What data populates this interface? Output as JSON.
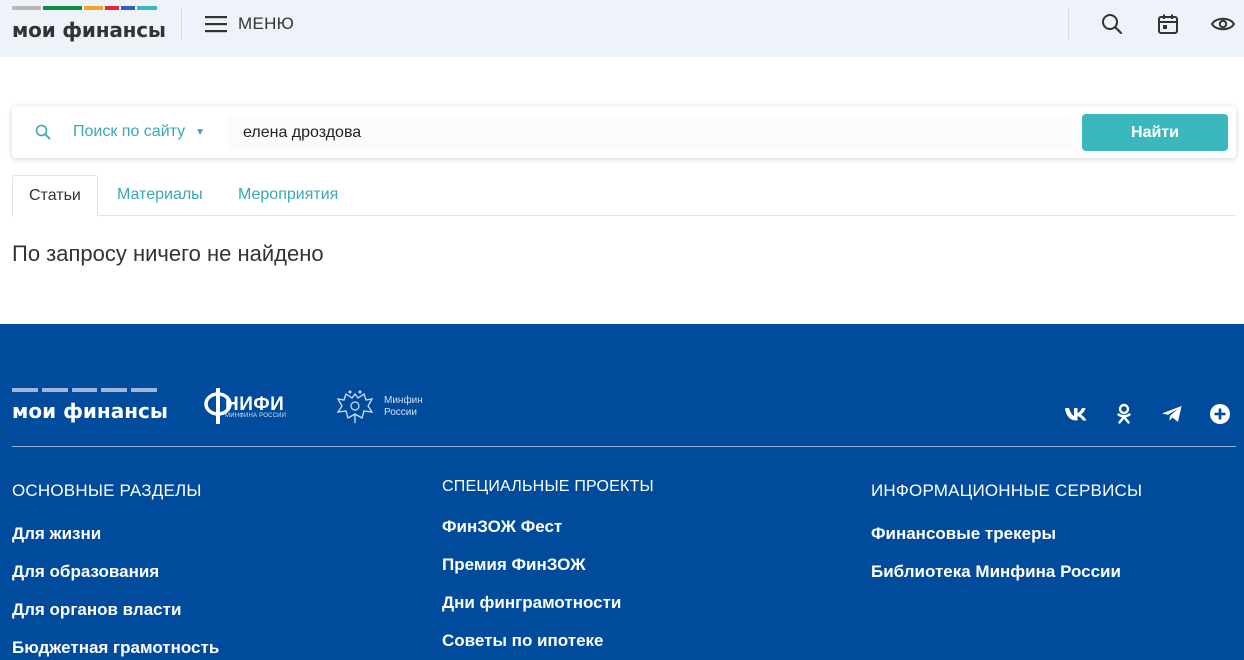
{
  "header": {
    "logo_text": "мои финансы",
    "logo_colors": [
      "#b8b8b8",
      "#3ab04a",
      "#0e7b3e",
      "#f0a326",
      "#e2263f",
      "#2f5fb4",
      "#3bb8be"
    ],
    "menu_label": "МЕНЮ",
    "icons": [
      "search-icon",
      "calendar-icon",
      "eye-icon"
    ]
  },
  "search": {
    "scope_label": "Поиск по сайту",
    "query": "елена дроздова",
    "submit_label": "Найти",
    "accent_color": "#3bb8be"
  },
  "tabs": [
    {
      "label": "Статьи",
      "active": true
    },
    {
      "label": "Материалы",
      "active": false
    },
    {
      "label": "Мероприятия",
      "active": false
    }
  ],
  "results": {
    "empty_message": "По запросу ничего не найдено"
  },
  "footer": {
    "background": "#004b9c",
    "logo_text": "мои финансы",
    "nifi_title": "НИФИ",
    "nifi_sub": "МИНФИНА РОССИИ",
    "minfin_line1": "Минфин",
    "minfin_line2": "России",
    "social_icons": [
      "vk-icon",
      "odnoklassniki-icon",
      "telegram-icon",
      "plus-circle-icon"
    ],
    "columns": [
      {
        "title": "ОСНОВНЫЕ РАЗДЕЛЫ",
        "links": [
          "Для жизни",
          "Для образования",
          "Для органов власти",
          "Бюджетная грамотность"
        ]
      },
      {
        "title": "СПЕЦИАЛЬНЫЕ ПРОЕКТЫ",
        "links": [
          "ФинЗОЖ Фест",
          "Премия ФинЗОЖ",
          "Дни финграмотности",
          "Советы по ипотеке"
        ]
      },
      {
        "title": "ИНФОРМАЦИОННЫЕ СЕРВИСЫ",
        "links": [
          "Финансовые трекеры",
          "Библиотека Минфина России"
        ]
      }
    ]
  }
}
